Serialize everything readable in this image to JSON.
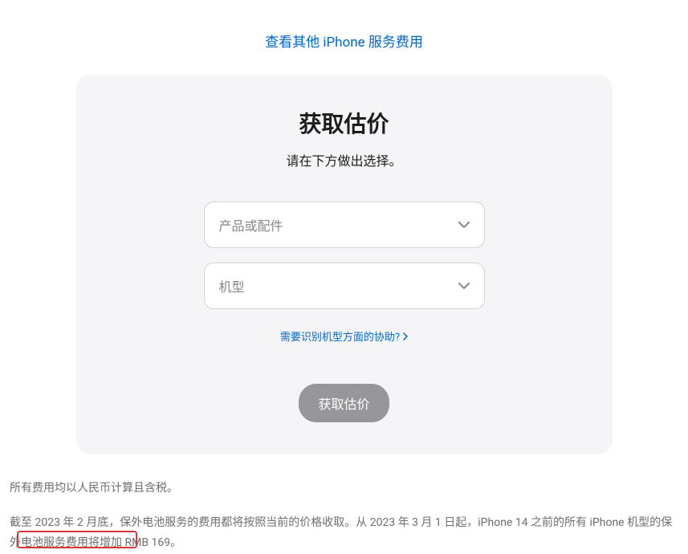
{
  "topLink": {
    "label": "查看其他 iPhone 服务费用"
  },
  "card": {
    "title": "获取估价",
    "subtitle": "请在下方做出选择。",
    "productSelect": {
      "placeholder": "产品或配件"
    },
    "modelSelect": {
      "placeholder": "机型"
    },
    "helpLink": {
      "label": "需要识别机型方面的协助?"
    },
    "button": {
      "label": "获取估价"
    }
  },
  "footer": {
    "line1": "所有费用均以人民币计算且含税。",
    "line2": "截至 2023 年 2 月底，保外电池服务的费用都将按照当前的价格收取。从 2023 年 3 月 1 日起，iPhone 14 之前的所有 iPhone 机型的保外电池服务费用将增加 RMB 169。"
  }
}
